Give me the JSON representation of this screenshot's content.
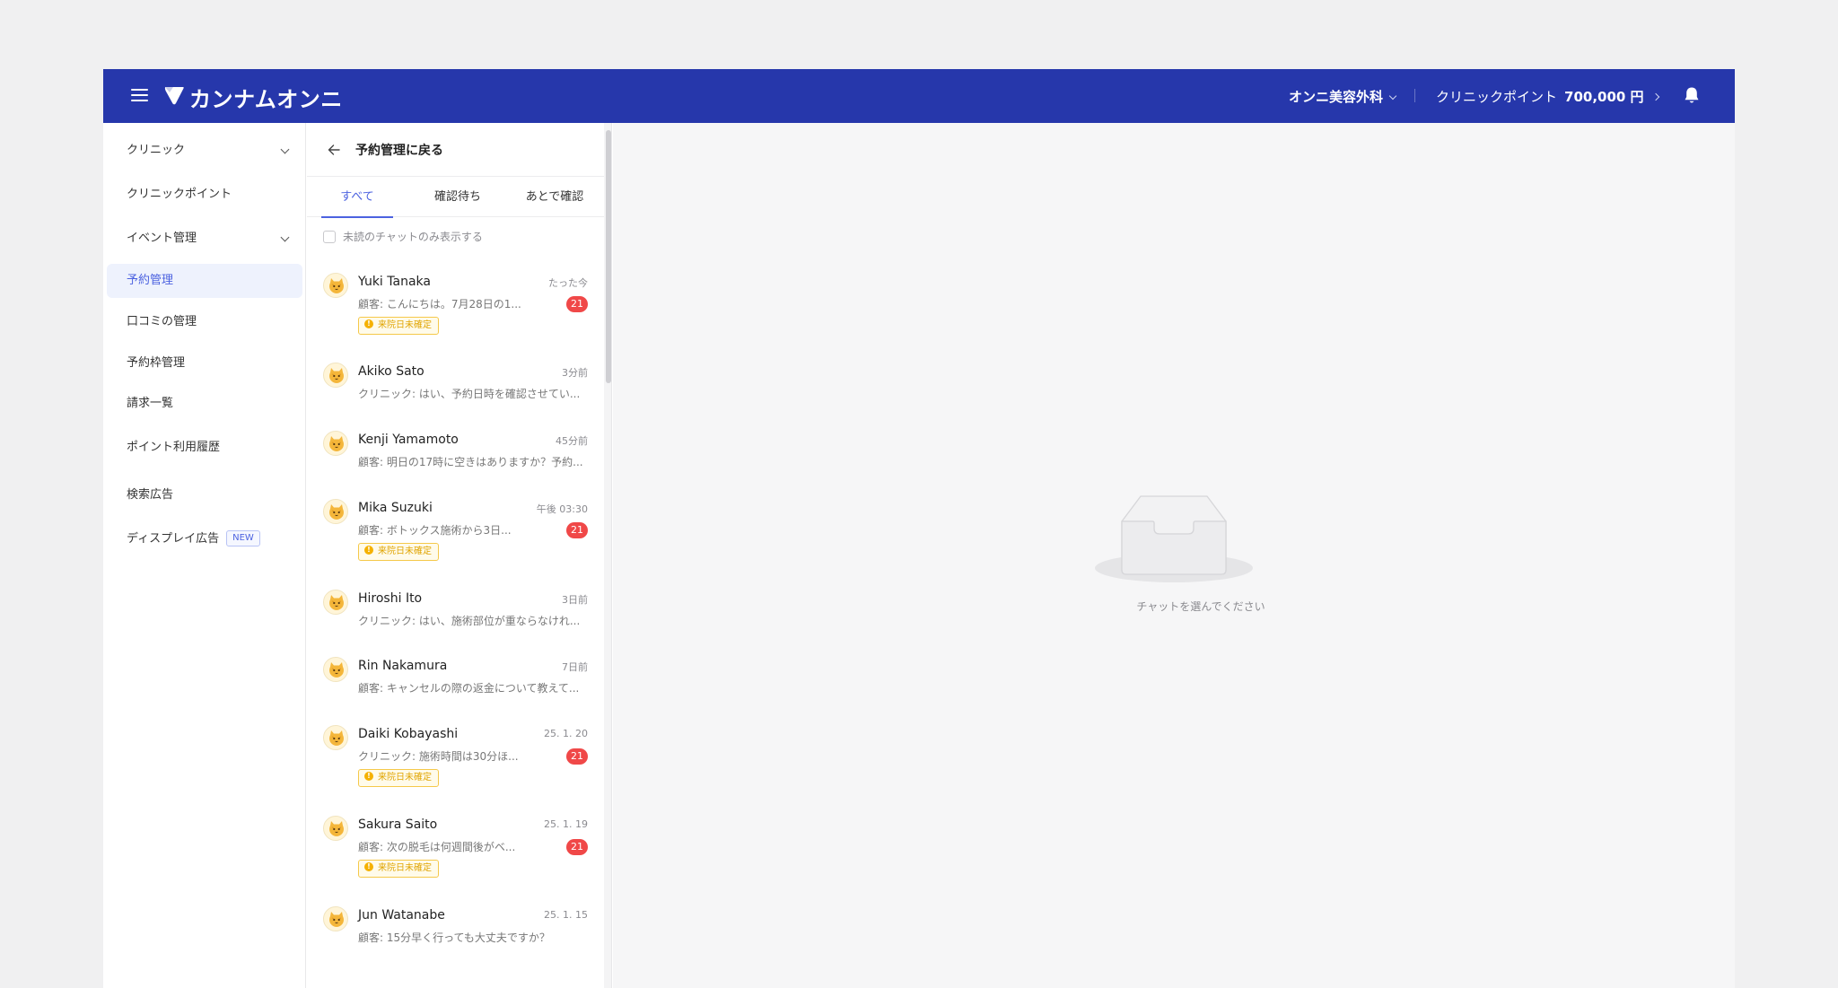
{
  "header": {
    "brand": "カンナムオンニ",
    "clinic_name": "オンニ美容外科",
    "points_label": "クリニックポイント",
    "points_value": "700,000 円",
    "brand_color": "#2637ab"
  },
  "sidebar": {
    "items": [
      {
        "label": "クリニック",
        "expandable": true
      },
      {
        "label": "クリニックポイント"
      },
      {
        "label": "イベント管理",
        "expandable": true
      },
      {
        "label": "予約管理",
        "active": true
      },
      {
        "label": "口コミの管理"
      },
      {
        "label": "予約枠管理"
      },
      {
        "label": "請求一覧"
      },
      {
        "label": "ポイント利用履歴"
      },
      {
        "label": "検索広告"
      },
      {
        "label": "ディスプレイ広告",
        "badge": "NEW"
      }
    ]
  },
  "chatlist": {
    "back_label": "予約管理に戻る",
    "tabs": [
      {
        "label": "すべて",
        "active": true
      },
      {
        "label": "確認待ち"
      },
      {
        "label": "あとで確認"
      }
    ],
    "filter_label": "未読のチャットのみ表示する",
    "items": [
      {
        "name": "Yuki Tanaka",
        "time": "たった今",
        "message": "顧客: こんにちは。7月28日の1...",
        "unread": "21",
        "tag": "来院日未確定"
      },
      {
        "name": "Akiko Sato",
        "time": "3分前",
        "message": "クリニック: はい、予約日時を確認させてい..."
      },
      {
        "name": "Kenji Yamamoto",
        "time": "45分前",
        "message": "顧客: 明日の17時に空きはありますか？予約..."
      },
      {
        "name": "Mika Suzuki",
        "time": "午後 03:30",
        "message": "顧客: ボトックス施術から3日...",
        "unread": "21",
        "tag": "来院日未確定"
      },
      {
        "name": "Hiroshi Ito",
        "time": "3日前",
        "message": "クリニック: はい、施術部位が重ならなけれ..."
      },
      {
        "name": "Rin Nakamura",
        "time": "7日前",
        "message": "顧客: キャンセルの際の返金について教えて..."
      },
      {
        "name": "Daiki Kobayashi",
        "time": "25. 1. 20",
        "message": "クリニック: 施術時間は30分ほ...",
        "unread": "21",
        "tag": "来院日未確定"
      },
      {
        "name": "Sakura Saito",
        "time": "25. 1. 19",
        "message": "顧客: 次の脱毛は何週間後がベ...",
        "unread": "21",
        "tag": "来院日未確定"
      },
      {
        "name": "Jun Watanabe",
        "time": "25. 1. 15",
        "message": "顧客: 15分早く行っても大丈夫ですか？"
      }
    ]
  },
  "main": {
    "empty_text": "チャットを選んでください"
  },
  "icons": {
    "menu": "hamburger-icon",
    "logo": "heart-logo-icon",
    "bell": "bell-icon",
    "back": "arrow-left-icon",
    "avatar": "cat-avatar-icon",
    "empty": "empty-inbox-icon"
  }
}
